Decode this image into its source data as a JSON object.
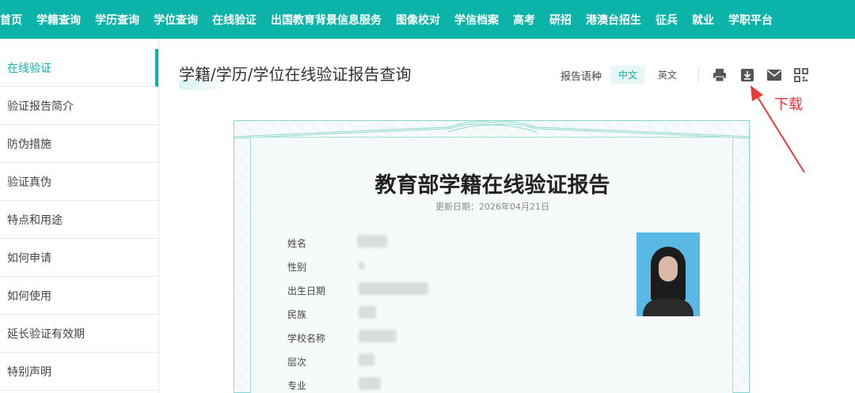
{
  "topnav": {
    "items": [
      "首页",
      "学籍查询",
      "学历查询",
      "学位查询",
      "在线验证",
      "出国教育背景信息服务",
      "图像校对",
      "学信档案",
      "高考",
      "研招",
      "港澳台招生",
      "征兵",
      "就业",
      "学职平台"
    ]
  },
  "sidebar": {
    "items": [
      "在线验证",
      "验证报告简介",
      "防伪措施",
      "验证真伪",
      "特点和用途",
      "如何申请",
      "如何使用",
      "延长验证有效期",
      "特别声明"
    ]
  },
  "main": {
    "title": "学籍/学历/学位在线验证报告查询",
    "lang_label": "报告语种",
    "lang_zh": "中文",
    "lang_en": "英文"
  },
  "toolbar": {
    "icons": [
      "print-icon",
      "download-icon",
      "mail-icon",
      "qrcode-icon"
    ]
  },
  "annotation": {
    "label": "下载",
    "color": "#e63b3b"
  },
  "certificate": {
    "title": "教育部学籍在线验证报告",
    "date_prefix": "更新日期：",
    "date_value": "2026年04月21日",
    "fields": [
      "姓名",
      "性别",
      "出生日期",
      "民族",
      "学校名称",
      "层次",
      "专业"
    ]
  },
  "colors": {
    "brand": "#0bb3a8",
    "annotation": "#e63b3b"
  }
}
